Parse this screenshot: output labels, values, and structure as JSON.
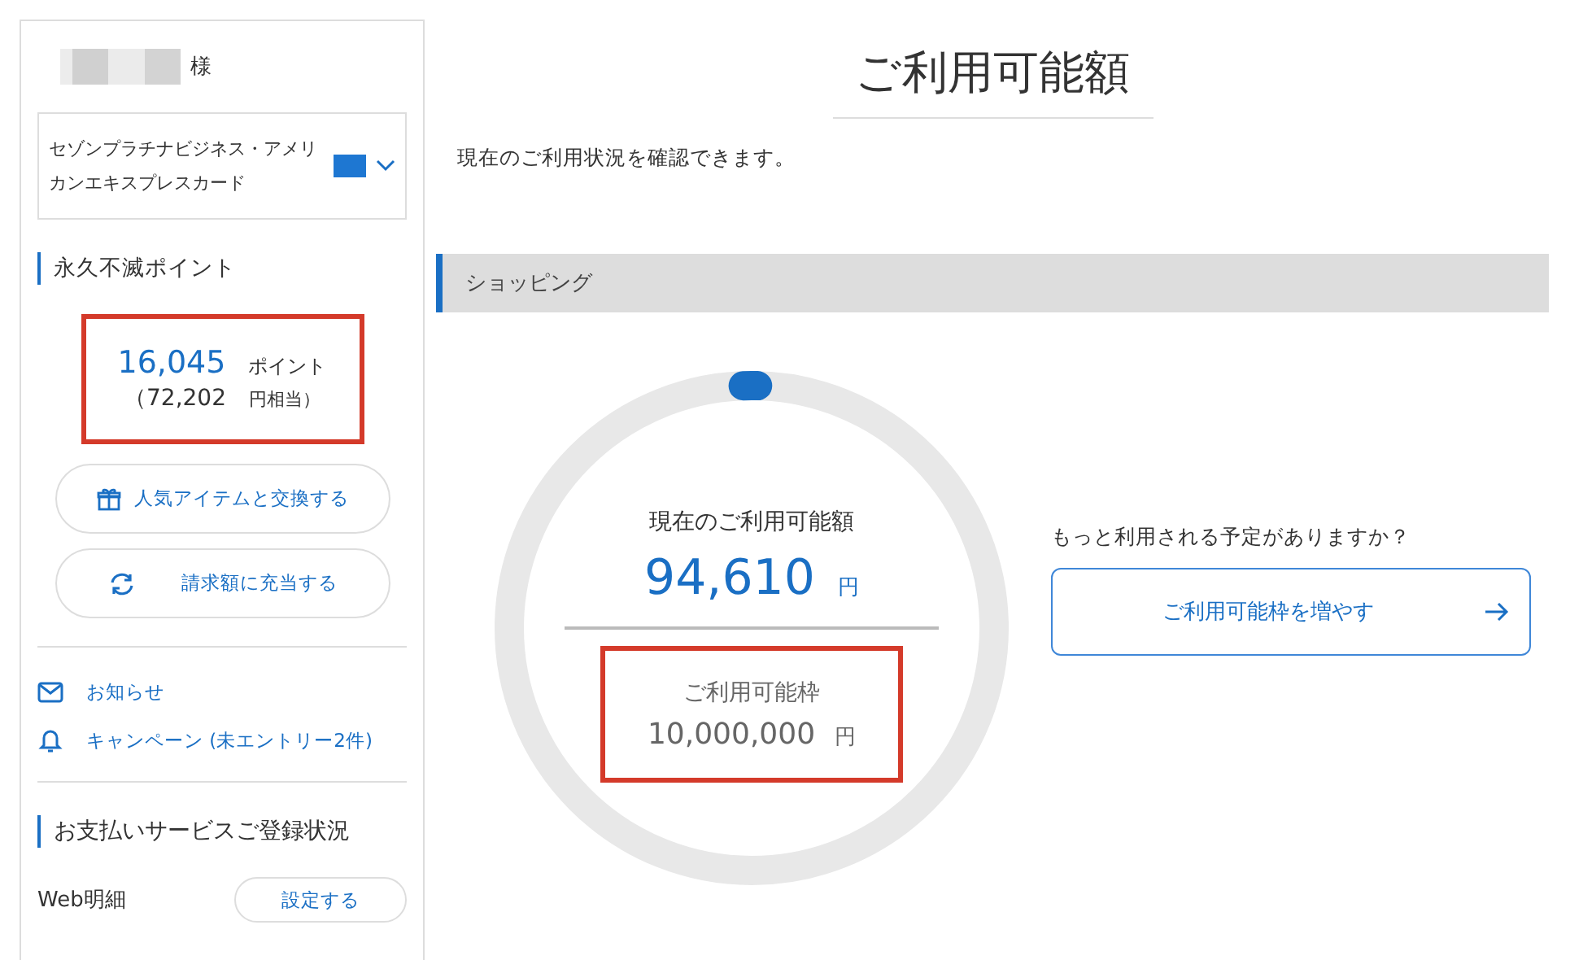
{
  "sidebar": {
    "honorific": "様",
    "card_select": {
      "value": "セゾンプラチナビジネス・アメリカンエキスプレスカード"
    },
    "points": {
      "heading": "永久不滅ポイント",
      "amount": "16,045",
      "unit": "ポイント",
      "equivalent": "（72,202",
      "equivalent_unit": "円相当）"
    },
    "buttons": [
      {
        "kind": "gift",
        "label": "人気アイテムと交換する"
      },
      {
        "kind": "refresh",
        "label": "請求額に充当する"
      }
    ],
    "links": [
      {
        "kind": "mail",
        "label": "お知らせ"
      },
      {
        "kind": "bell",
        "label": "キャンペーン (未エントリー2件)"
      }
    ],
    "services": {
      "heading": "お支払いサービスご登録状況",
      "rows": [
        {
          "label": "Web明細",
          "button": "設定する"
        }
      ]
    }
  },
  "main": {
    "title": "ご利用可能額",
    "description": "現在のご利用状況を確認できます。",
    "section": "ショッピング",
    "gauge": {
      "level": 0.0095,
      "label": "現在のご利用可能額",
      "amount": "94,610",
      "unit": "円",
      "limit_label": "ご利用可能枠",
      "limit_amount": "10,000,000",
      "limit_unit": "円"
    },
    "prompt": "もっと利用される予定がありますか？",
    "cta": "ご利用可能枠を増やす"
  }
}
